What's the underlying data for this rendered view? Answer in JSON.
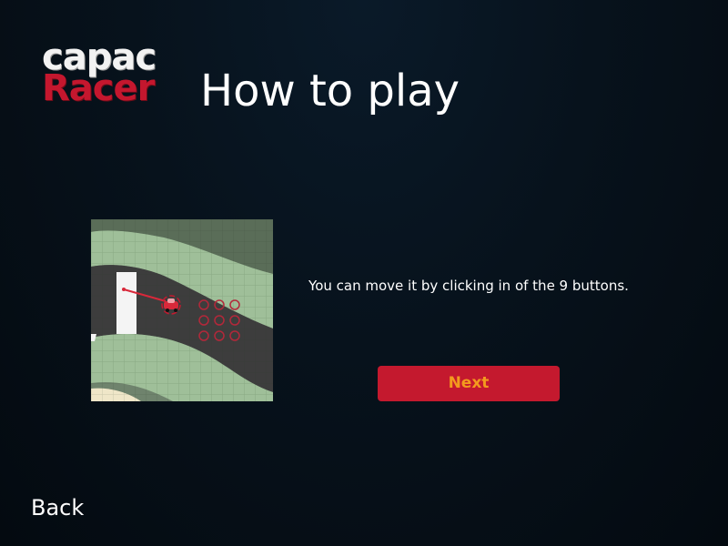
{
  "header": {
    "logo_line1": "capac",
    "logo_line2": "Racer",
    "title": "How to play"
  },
  "tutorial": {
    "instruction": "You can move it by clicking in of the 9 buttons.",
    "next_label": "Next",
    "illustration_icon": "race-track-car-control-grid"
  },
  "footer": {
    "back_label": "Back"
  },
  "colors": {
    "accent_red": "#c4192e",
    "button_text_orange": "#f39a1e",
    "background": "#07121c",
    "grass": "#9fbf99",
    "road": "#3d3d3d"
  }
}
